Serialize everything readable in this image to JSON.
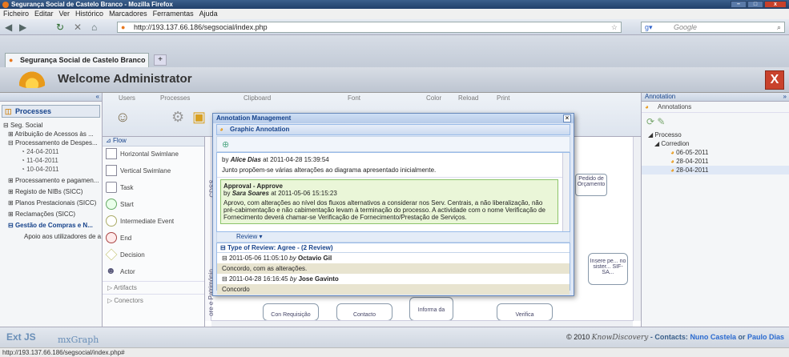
{
  "window": {
    "title": "Segurança Social de Castelo Branco - Mozilla Firefox"
  },
  "menu": [
    "Ficheiro",
    "Editar",
    "Ver",
    "Histórico",
    "Marcadores",
    "Ferramentas",
    "Ajuda"
  ],
  "nav": {
    "url": "http://193.137.66.186/segsocial/index.php",
    "search_placeholder": "Google"
  },
  "tab": {
    "label": "Segurança Social de Castelo Branco",
    "new_tab": "+"
  },
  "header": {
    "welcome": "Welcome Administrator",
    "close": "X"
  },
  "left": {
    "collapse": "«",
    "processes_btn": "Processes",
    "tree": [
      "Seg. Social",
      "Atribuição de Acessos às ...",
      "Processamento de Despes...",
      "24-04-2011",
      "11-04-2011",
      "10-04-2011",
      "Processamento e pagamen...",
      "Registo de NIBs (SICC)",
      "Planos Prestacionais (SICC)",
      "Reclamações (SICC)",
      "Gestão de Compras e N...",
      "Apoio aos utilizadores de a..."
    ]
  },
  "toolbar": {
    "groups": [
      "Users",
      "Processes",
      "Clipboard",
      "Font",
      "Color",
      "Reload",
      "Print"
    ]
  },
  "shapes": {
    "flow": "Flow",
    "items": [
      "Horizontal Swimlane",
      "Vertical Swimlane",
      "Task",
      "Start",
      "Intermediate Event",
      "End",
      "Decision",
      "Actor"
    ],
    "artifacts": "Artifacts",
    "connectors": "Conectors"
  },
  "canvas": {
    "lane1": "CDSS",
    "lane2": "ore e Património",
    "box1": "Pedido de Orçamento",
    "box2": "Insere pe... no sister... SIF-SA...",
    "box3": "Informa da",
    "box4": "Con Requisição",
    "box5": "Contacto",
    "box6": "Verifica"
  },
  "dialog": {
    "title": "Annotation Management",
    "close": "×",
    "section": "Graphic Annotation",
    "comment_by": "by",
    "comment_author": "Alice Dias",
    "comment_at": "at 2011-04-28 15:39:54",
    "comment_text": "Junto propõem-se várias alterações ao diagrama apresentado inicialmente.",
    "approval_title": "Approval - Approve",
    "approval_author": "Sara Soares",
    "approval_at": "at 2011-05-06 15:15:23",
    "approval_text": "Aprovo, com alterações ao nível dos fluxos alternativos a considerar nos Serv. Centrais, a não liberalização, não pré-cabimentação e não cabimentação levam à terminação do processo. A actividade com o nome Verificação de Fornecimento deverá chamar-se Verificação de Fornecimento/Prestação de Serviços.",
    "review_btn": "Review",
    "review_group": "Type of Review: Agree - (2 Review)",
    "reviews": [
      {
        "date": "2011-05-06 11:05:10",
        "by": "by",
        "author": "Octavio Gil",
        "text": "Concordo, com as alterações."
      },
      {
        "date": "2011-04-28 16:16:45",
        "by": "by",
        "author": "Jose Gavinto",
        "text": "Concordo"
      }
    ]
  },
  "right": {
    "title": "Annotation",
    "collapse": "»",
    "annotations": "Annotations",
    "tree": [
      "Processo",
      "Corredion",
      "06-05-2011",
      "28-04-2011",
      "28-04-2011"
    ]
  },
  "footer": {
    "extjs": "Ext JS",
    "mxgraph": "mxGraph",
    "copyright": "© 2010",
    "brand": "KnowDiscovery",
    "contacts": "- Contacts:",
    "author1": "Nuno Castela",
    "or": "or",
    "author2": "Paulo Dias"
  },
  "status": "http://193.137.66.186/segsocial/index.php#"
}
